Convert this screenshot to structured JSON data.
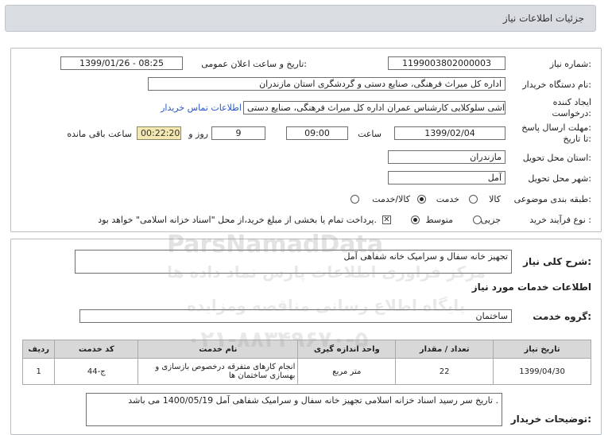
{
  "header": {
    "title": "جزئیات اطلاعات نیاز"
  },
  "need": {
    "number_label": "شماره نیاز:",
    "number_value": "1199003802000003",
    "announce_label": "تاریخ و ساعت اعلان عمومی:",
    "announce_value": "1399/01/26 - 08:25",
    "buyer_label": "نام دستگاه خریدار:",
    "buyer_value": "اداره کل میراث فرهنگی، صنایع دستی و گردشگری استان مازندران",
    "creator_label_1": "ایجاد کننده",
    "creator_label_2": "درخواست:",
    "creator_value": "امین داداشی سلوکلایی کارشناس عمران اداره کل میراث فرهنگی، صنایع دستی",
    "contact_link": "اطلاعات تماس خریدار",
    "deadline_label_1": "مهلت ارسال پاسخ:",
    "deadline_label_2": "تا تاریخ:",
    "deadline_date": "1399/02/04",
    "time_label": "ساعت",
    "deadline_time": "09:00",
    "days_value": "9",
    "days_label": "روز و",
    "remaining_value": "00:22:20",
    "remaining_label": "ساعت باقی مانده",
    "province_label": "استان محل تحویل:",
    "province_value": "مازندران",
    "city_label": "شهر محل تحویل:",
    "city_value": "آمل",
    "category_label": "طبقه بندی موضوعی:",
    "category_options": [
      "کالا",
      "خدمت",
      "کالا/خدمت"
    ],
    "category_selected": "خدمت",
    "process_label": "نوع فرآیند خرید :",
    "process_options": [
      "جزیی",
      "متوسط"
    ],
    "process_selected": "متوسط",
    "payment_note": "پرداخت تمام یا بخشی از مبلغ خرید،از محل \"اسناد خزانه اسلامی\" خواهد بود."
  },
  "description": {
    "general_label": "شرح کلی نیاز:",
    "general_value": "تجهیز خانه سفال و سرامیک خانه شفاهی آمل",
    "services_title": "اطلاعات خدمات مورد نیاز",
    "group_label": "گروه خدمت:",
    "group_value": "ساختمان"
  },
  "table": {
    "headers": [
      "ردیف",
      "کد خدمت",
      "نام خدمت",
      "واحد اندازه گیری",
      "تعداد / مقدار",
      "تاریخ نیاز"
    ],
    "rows": [
      [
        "1",
        "ج-44",
        "انجام کارهای متفرقه درخصوص بازسازی و بهسازی ساختمان ها",
        "متر مربع",
        "22",
        "1399/04/30"
      ]
    ]
  },
  "notes": {
    "label": "توضیحات خریدار:",
    "value": "تاریخ سر رسید اسناد خزانه اسلامی تجهیز خانه سفال و سرامیک شفاهی آمل 1400/05/19 می باشد ."
  },
  "watermark": {
    "brand": "ParsNamadData",
    "line1": "مرکز فراوری اطلاعات پارس نماد داده ها",
    "line2": "پایگاه اطلاع رسانی مناقصه ومزایده",
    "phone": "۰۲۱-۸۸۳۴۹۶۷۰-۵"
  },
  "colors": {
    "header_bg": "#d9dde2",
    "link": "#2a56c6",
    "timer_bg": "#f5e7b0",
    "table_header_bg": "#d8d8d8"
  }
}
